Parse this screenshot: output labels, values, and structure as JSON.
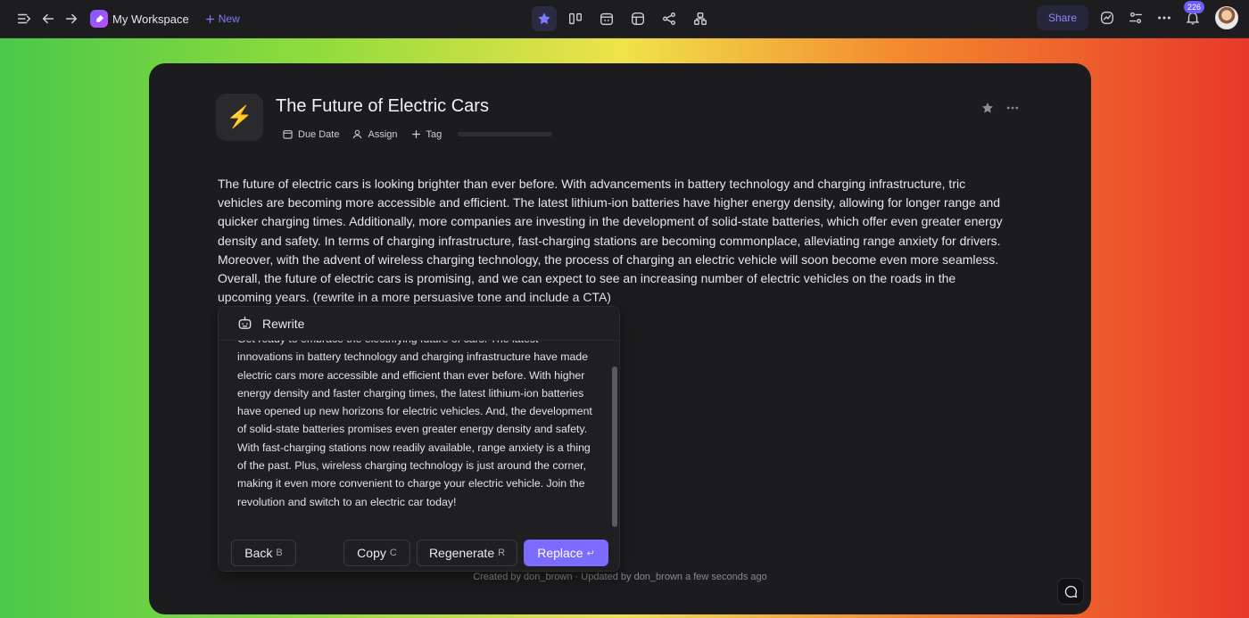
{
  "topbar": {
    "workspace_name": "My Workspace",
    "new_label": "New",
    "share_label": "Share",
    "notification_count": "226"
  },
  "document": {
    "icon": "⚡",
    "title": "The Future of Electric Cars",
    "meta": {
      "due_date_label": "Due Date",
      "assign_label": "Assign",
      "tag_label": "Tag"
    },
    "body": "The future of electric cars is looking brighter than ever before. With advancements in battery technology and charging infrastructure, tric vehicles are becoming more accessible and efficient. The latest lithium-ion batteries have higher energy density, allowing for longer range and quicker charging times. Additionally, more companies are investing in the development of solid-state batteries, which offer even greater energy density and safety. In terms of charging infrastructure, fast-charging stations are becoming commonplace, alleviating range anxiety for drivers. Moreover, with the advent of wireless charging technology, the process of charging an electric vehicle will soon become even more seamless. Overall, the future of electric cars is promising, and we can expect to see an increasing number of electric vehicles on the roads in the upcoming years. (rewrite in a more persuasive tone and include a CTA)",
    "footer": "Created by don_brown · Updated by don_brown a few seconds ago"
  },
  "rewrite": {
    "title": "Rewrite",
    "text": "Get ready to embrace the electrifying future of cars. The latest innovations in battery technology and charging infrastructure have made electric cars more accessible and efficient than ever before. With higher energy density and faster charging times, the latest lithium-ion batteries have opened up new horizons for electric vehicles. And, the development of solid-state batteries promises even greater energy density and safety. With fast-charging stations now readily available, range anxiety is a thing of the past. Plus, wireless charging technology is just around the corner, making it even more convenient to charge your electric vehicle. Join the revolution and switch to an electric car today!",
    "buttons": {
      "back": {
        "label": "Back",
        "key": "B"
      },
      "copy": {
        "label": "Copy",
        "key": "C"
      },
      "regenerate": {
        "label": "Regenerate",
        "key": "R"
      },
      "replace": {
        "label": "Replace",
        "key": "↵"
      }
    }
  },
  "colors": {
    "accent": "#7b6cff",
    "card_bg": "#1c1c1e"
  }
}
